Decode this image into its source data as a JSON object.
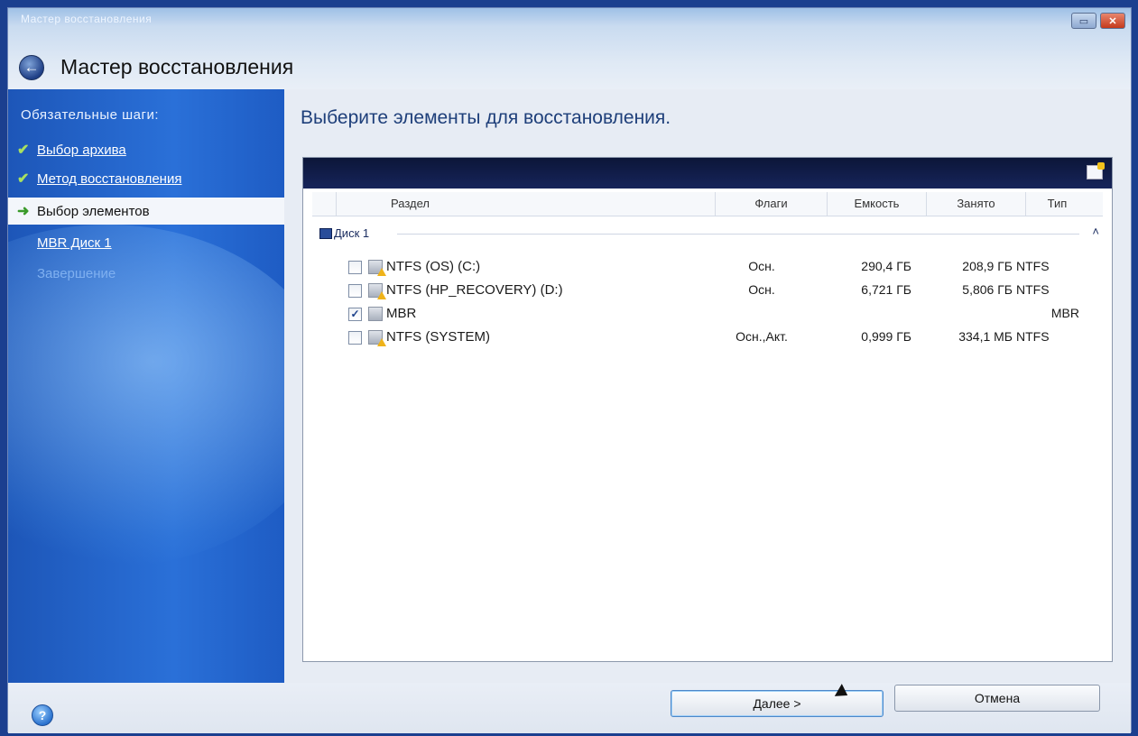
{
  "window": {
    "small_title": "Мастер восстановления",
    "title": "Мастер восстановления",
    "restore_label": "▭",
    "close_label": "✕",
    "back_label": "←"
  },
  "sidebar": {
    "header": "Обязательные шаги:",
    "steps": [
      {
        "label": "Выбор архива",
        "state": "done",
        "icon": "check-icon"
      },
      {
        "label": "Метод восстановления",
        "state": "done",
        "icon": "check-icon"
      },
      {
        "label": "Выбор элементов",
        "state": "current",
        "icon": "arrow-right-icon"
      },
      {
        "label": "MBR Диск 1",
        "state": "link",
        "icon": ""
      },
      {
        "label": "Завершение",
        "state": "disabled",
        "icon": ""
      }
    ]
  },
  "main": {
    "title": "Выберите элементы для восстановления.",
    "columns": {
      "name": "Раздел",
      "flags": "Флаги",
      "capacity": "Емкость",
      "used": "Занято",
      "type": "Тип"
    },
    "disk": {
      "label": "Диск 1",
      "collapse_label": "˄"
    },
    "rows": [
      {
        "name": "NTFS (OS) (C:)",
        "flags": "Осн.",
        "capacity": "290,4 ГБ",
        "used": "208,9 ГБ",
        "type": "NTFS",
        "checked": false,
        "check_mark": ""
      },
      {
        "name": "NTFS (HP_RECOVERY) (D:)",
        "flags": "Осн.",
        "capacity": "6,721 ГБ",
        "used": "5,806 ГБ",
        "type": "NTFS",
        "checked": false,
        "check_mark": ""
      },
      {
        "name": "MBR",
        "flags": "",
        "capacity": "",
        "used": "",
        "type": "MBR",
        "checked": true,
        "check_mark": "✓"
      },
      {
        "name": "NTFS (SYSTEM)",
        "flags": "Осн.,Акт.",
        "capacity": "0,999 ГБ",
        "used": "334,1 МБ",
        "type": "NTFS",
        "checked": false,
        "check_mark": ""
      }
    ]
  },
  "footer": {
    "help_label": "?",
    "next_label": "Далее >",
    "cancel_label": "Отмена"
  },
  "colors": {
    "sidebar": "#2a70d8",
    "accent": "#1e3f7a",
    "close": "#c43a1c"
  }
}
